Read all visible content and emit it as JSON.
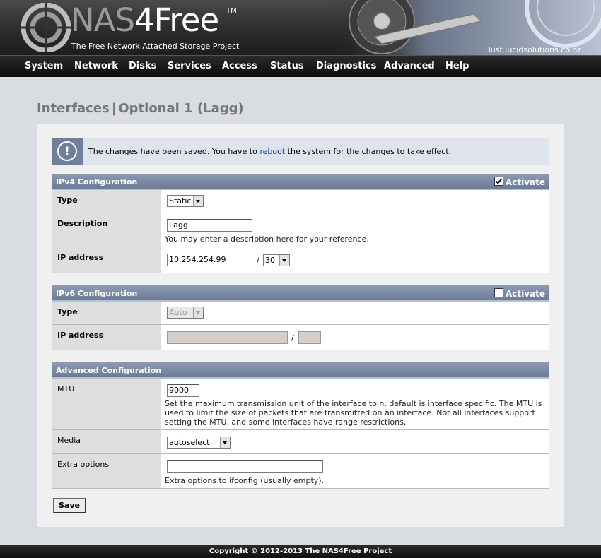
{
  "header": {
    "logo_nas": "NAS",
    "logo_free": "4Free",
    "logo_tm": "TM",
    "tagline": "The Free Network Attached Storage Project",
    "hostname": "lust.lucidsolutions.co.nz"
  },
  "nav": [
    "System",
    "Network",
    "Disks",
    "Services",
    "Access",
    "Status",
    "Diagnostics",
    "Advanced",
    "Help"
  ],
  "page": {
    "title_part1": "Interfaces",
    "title_sep": "|",
    "title_part2": "Optional 1 (Lagg)"
  },
  "message": {
    "icon": "info-icon",
    "text_before": "The changes have been saved. You have to ",
    "link": "reboot",
    "text_after": " the system for the changes to take effect."
  },
  "ipv4": {
    "title": "IPv4 Configuration",
    "activate_label": "Activate",
    "activate_checked": true,
    "type_label": "Type",
    "type_value": "Static",
    "description_label": "Description",
    "description_value": "Lagg",
    "description_help": "You may enter a description here for your reference.",
    "ip_label": "IP address",
    "ip_value": "10.254.254.99",
    "slash": "/",
    "mask_value": "30"
  },
  "ipv6": {
    "title": "IPv6 Configuration",
    "activate_label": "Activate",
    "activate_checked": false,
    "type_label": "Type",
    "type_value": "Auto",
    "ip_label": "IP address",
    "ip_value": "",
    "slash": "/",
    "prefix_value": ""
  },
  "advanced": {
    "title": "Advanced Configuration",
    "mtu_label": "MTU",
    "mtu_value": "9000",
    "mtu_help": "Set the maximum transmission unit of the interface to n, default is interface specific. The MTU is used to limit the size of packets that are transmitted on an interface. Not all interfaces support setting the MTU, and some interfaces have range restrictions.",
    "media_label": "Media",
    "media_value": "autoselect",
    "extra_label": "Extra options",
    "extra_value": "",
    "extra_help": "Extra options to ifconfig (usually empty)."
  },
  "save_label": "Save",
  "footer": "Copyright © 2012-2013 The NAS4Free Project"
}
